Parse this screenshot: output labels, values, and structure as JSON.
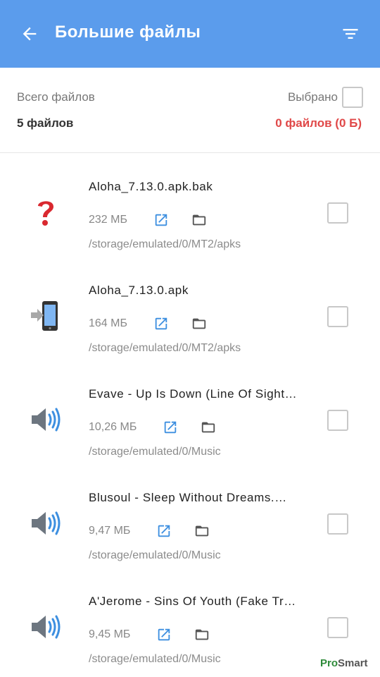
{
  "appbar": {
    "title": "Большие файлы",
    "back_icon": "arrow-left-icon",
    "filter_icon": "filter-icon",
    "color": "#5b9cec"
  },
  "summary": {
    "total_label": "Всего файлов",
    "total_value": "5 файлов",
    "selected_label": "Выбрано",
    "selected_value": "0 файлов (0 Б)",
    "selected_color": "#e04848",
    "select_all_checked": false
  },
  "files": [
    {
      "name": "Aloha_7.13.0.apk.bak",
      "size": "232 МБ",
      "path": "/storage/emulated/0/MT2/apks",
      "icon": "unknown-file-icon",
      "checked": false
    },
    {
      "name": "Aloha_7.13.0.apk",
      "size": "164 МБ",
      "path": "/storage/emulated/0/MT2/apks",
      "icon": "apk-install-icon",
      "checked": false
    },
    {
      "name": "Evave - Up Is Down (Line Of Sight…",
      "size": "10,26 МБ",
      "path": "/storage/emulated/0/Music",
      "icon": "speaker-icon",
      "checked": false
    },
    {
      "name": "Blusoul - Sleep Without Dreams.…",
      "size": "9,47 МБ",
      "path": "/storage/emulated/0/Music",
      "icon": "speaker-icon",
      "checked": false
    },
    {
      "name": "A'Jerome - Sins Of Youth (Fake Tr…",
      "size": "9,45 МБ",
      "path": "/storage/emulated/0/Music",
      "icon": "speaker-icon",
      "checked": false
    }
  ],
  "accent_color": "#3d8fe0",
  "watermark": {
    "part1": "Pro",
    "part2": "Smart"
  }
}
